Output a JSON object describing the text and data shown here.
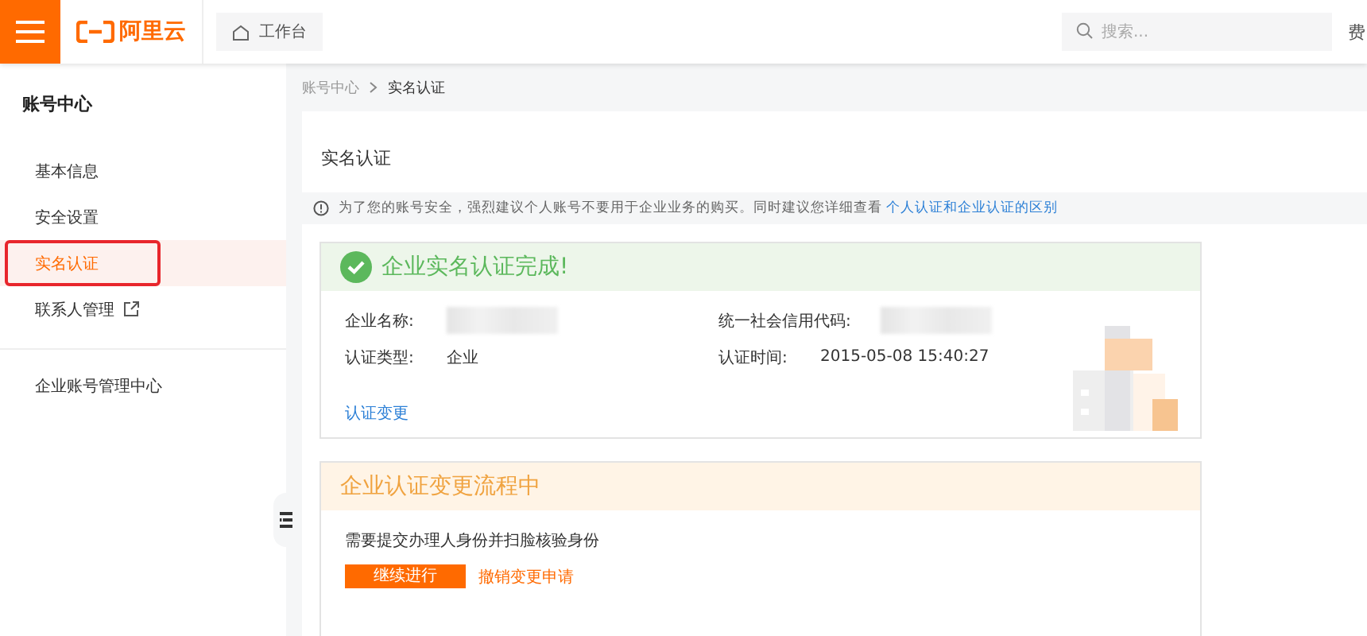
{
  "header": {
    "logo": "阿里云",
    "workbench": "工作台",
    "search": {
      "placeholder": "搜索..."
    },
    "right_text": "费"
  },
  "sidebar": {
    "title": "账号中心",
    "items": [
      {
        "label": "基本信息",
        "selected": false,
        "annotated": false,
        "external": false
      },
      {
        "label": "安全设置",
        "selected": false,
        "annotated": false,
        "external": false
      },
      {
        "label": "实名认证",
        "selected": true,
        "annotated": true,
        "external": false
      },
      {
        "label": "联系人管理",
        "selected": false,
        "annotated": false,
        "external": true
      }
    ],
    "footer_item": "企业账号管理中心"
  },
  "breadcrumb": [
    "账号中心",
    "实名认证"
  ],
  "page_title": "实名认证",
  "notice": {
    "text": "为了您的账号安全，强烈建议个人账号不要用于企业业务的购买。同时建议您详细查看",
    "link": "个人认证和企业认证的区别"
  },
  "status_card": {
    "title": "企业实名认证完成!",
    "fields": [
      {
        "label": "企业名称:",
        "masked": true
      },
      {
        "label": "统一社会信用代码:",
        "masked": true
      },
      {
        "label": "认证类型:",
        "value": "企业",
        "masked": false
      },
      {
        "label": "认证时间:",
        "value": "2015-05-08 15:40:27",
        "masked": false
      }
    ],
    "link": "认证变更"
  },
  "process_card": {
    "title": "企业认证变更流程中",
    "text": "需要提交办理人身份并扫脸核验身份",
    "primary_button": "继续进行",
    "secondary_link": "撤销变更申请"
  }
}
